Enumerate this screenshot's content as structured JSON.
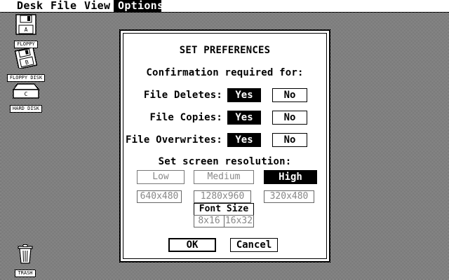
{
  "menubar": {
    "items": [
      "Desk",
      "File",
      "View",
      "Options"
    ],
    "active": "Options"
  },
  "desktop": {
    "icons": [
      {
        "name": "floppy-a",
        "label": "FLOPPY"
      },
      {
        "name": "floppy-b",
        "label": "FLOPPY DISK"
      },
      {
        "name": "hard-disk",
        "label": "HARD DISK"
      },
      {
        "name": "trash",
        "label": "TRASH"
      }
    ],
    "icon_glyph_letters": {
      "floppy_a": "A",
      "floppy_b": "B",
      "hard_disk": "C"
    }
  },
  "dialog": {
    "title": "SET PREFERENCES",
    "confirm_heading": "Confirmation required for:",
    "rows": [
      {
        "label": "File Deletes:",
        "yes": "Yes",
        "no": "No",
        "selected": "yes"
      },
      {
        "label": "File Copies:",
        "yes": "Yes",
        "no": "No",
        "selected": "yes"
      },
      {
        "label": "File Overwrites:",
        "yes": "Yes",
        "no": "No",
        "selected": "yes"
      }
    ],
    "resolution_heading": "Set screen resolution:",
    "resolutions": [
      {
        "label": "Low",
        "size": "640x480",
        "enabled": false
      },
      {
        "label": "Medium",
        "size": "1280x960",
        "enabled": false
      },
      {
        "label": "High",
        "size": "320x480",
        "enabled": true,
        "selected": true
      }
    ],
    "font_size": {
      "label": "Font Size",
      "options": [
        "8x16",
        "16x32"
      ]
    },
    "ok_label": "OK",
    "cancel_label": "Cancel"
  },
  "colors": {
    "foreground": "#000000",
    "background": "#ffffff",
    "disabled": "#888888"
  }
}
